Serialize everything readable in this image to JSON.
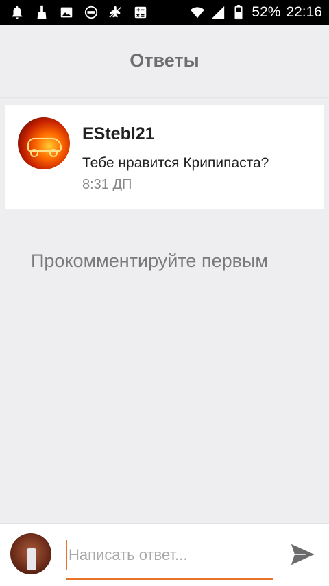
{
  "status_bar": {
    "battery_percent": "52%",
    "time": "22:16",
    "left_icons": [
      "bell-icon",
      "broom-icon",
      "image-icon",
      "free-icon",
      "airplane-off-icon",
      "calculator-icon"
    ],
    "right_icons": [
      "wifi-icon",
      "signal-icon",
      "battery-icon"
    ]
  },
  "header": {
    "title": "Ответы"
  },
  "post": {
    "author": "EStebl21",
    "text": "Тебе нравится Крипипаста?",
    "time": "8:31 ДП"
  },
  "empty_state": {
    "message": "Прокомментируйте первым"
  },
  "reply": {
    "placeholder": "Написать ответ...",
    "value": ""
  },
  "colors": {
    "accent": "#e8742a",
    "background": "#eeeef0",
    "card": "#ffffff",
    "header_text": "#6e6e70"
  }
}
